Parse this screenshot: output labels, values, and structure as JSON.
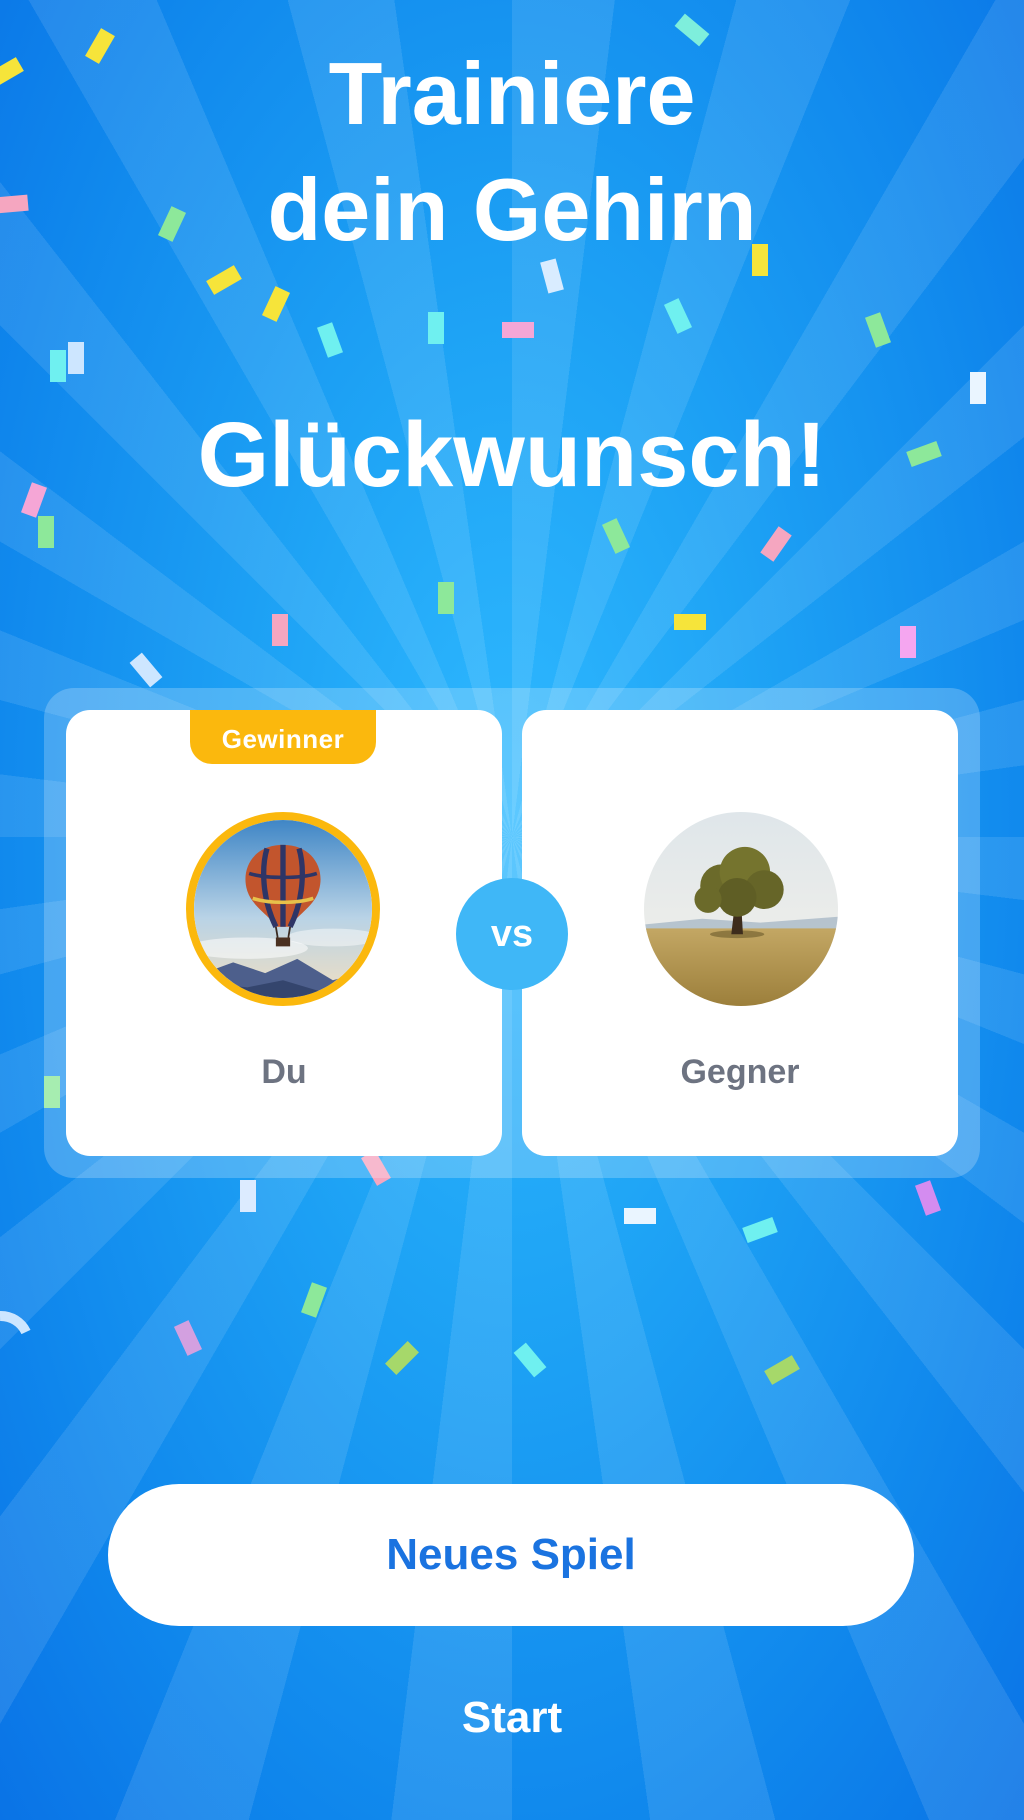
{
  "header": {
    "title_line1": "Trainiere",
    "title_line2": "dein Gehirn"
  },
  "result": {
    "message": "Glückwunsch!"
  },
  "match": {
    "winner_badge": "Gewinner",
    "vs_label": "vs",
    "player": {
      "name": "Du",
      "avatar": "hot-air-balloon-photo"
    },
    "opponent": {
      "name": "Gegner",
      "avatar": "tree-in-field-photo"
    }
  },
  "actions": {
    "new_game_label": "Neues Spiel",
    "start_label": "Start"
  },
  "colors": {
    "background": "#1e9ff5",
    "accent_gold": "#fbb80d",
    "button_text": "#1a73e0",
    "name_text": "#6d7381",
    "vs_circle": "#3fb7f7"
  },
  "decorations": {
    "background_pattern": "sunburst-rays",
    "particles": "confetti"
  }
}
